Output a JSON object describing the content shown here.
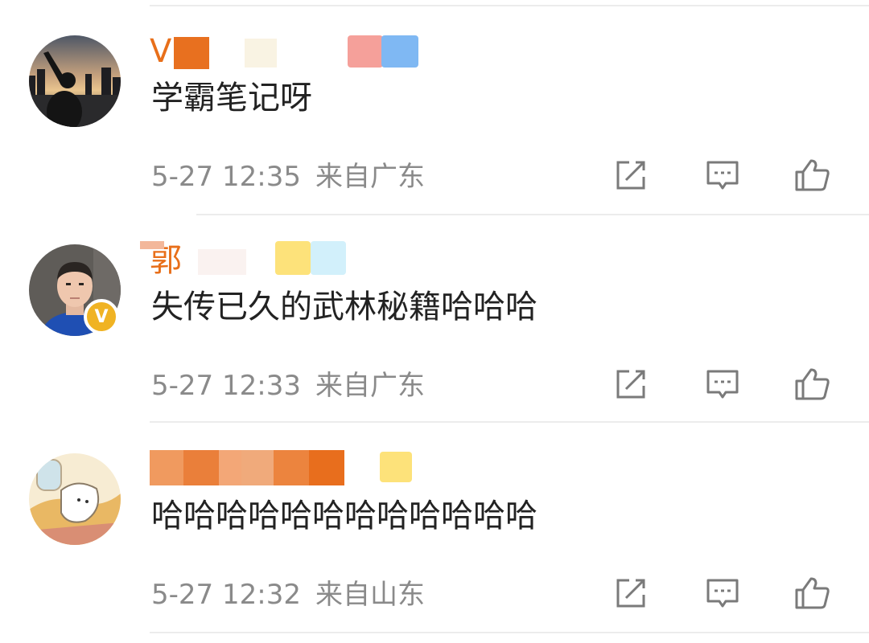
{
  "comments": [
    {
      "name_visible": "V",
      "text": "学霸笔记呀",
      "time": "5-27 12:35",
      "source": "来自广东"
    },
    {
      "name_visible": "郭",
      "text": "失传已久的武林秘籍哈哈哈",
      "time": "5-27 12:33",
      "source": "来自广东"
    },
    {
      "name_visible": "",
      "text": "哈哈哈哈哈哈哈哈哈哈哈哈",
      "time": "5-27 12:32",
      "source": "来自山东"
    }
  ],
  "actions": {
    "share": "share-icon",
    "reply": "comment-icon",
    "like": "thumbs-up-icon"
  },
  "colors": {
    "name": "#e86f1a",
    "body_text": "#222222",
    "meta": "#8a8a8a",
    "icon": "#7a7a7a",
    "verified": "#f0b323"
  }
}
